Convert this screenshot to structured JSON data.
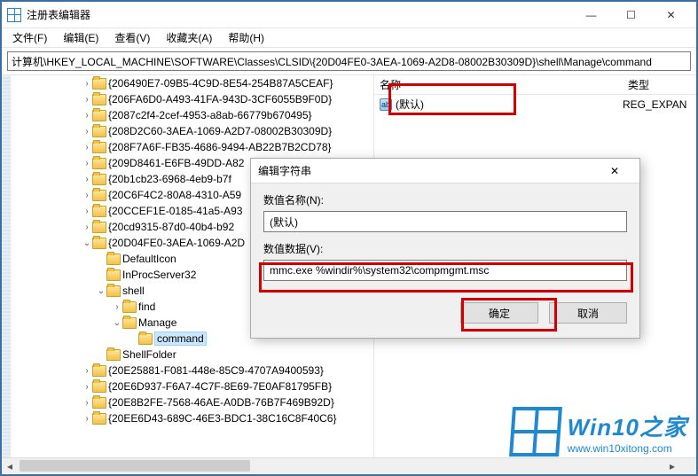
{
  "window": {
    "title": "注册表编辑器",
    "min_tip": "Minimize",
    "max_tip": "Maximize",
    "close_tip": "Close"
  },
  "menu": {
    "file": "文件(F)",
    "edit": "编辑(E)",
    "view": "查看(V)",
    "favorites": "收藏夹(A)",
    "help": "帮助(H)"
  },
  "address": "计算机\\HKEY_LOCAL_MACHINE\\SOFTWARE\\Classes\\CLSID\\{20D04FE0-3AEA-1069-A2D8-08002B30309D}\\shell\\Manage\\command",
  "tree": {
    "items": [
      {
        "label": "{206490E7-09B5-4C9D-8E54-254B87A5CEAF}",
        "indent": 2,
        "exp": ">"
      },
      {
        "label": "{206FA6D0-A493-41FA-943D-3CF6055B9F0D}",
        "indent": 2,
        "exp": ">"
      },
      {
        "label": "{2087c2f4-2cef-4953-a8ab-66779b670495}",
        "indent": 2,
        "exp": ">"
      },
      {
        "label": "{208D2C60-3AEA-1069-A2D7-08002B30309D}",
        "indent": 2,
        "exp": ">"
      },
      {
        "label": "{208F7A6F-FB35-4686-9494-AB22B7B2CD78}",
        "indent": 2,
        "exp": ">"
      },
      {
        "label": "{209D8461-E6FB-49DD-A82",
        "indent": 2,
        "exp": ">"
      },
      {
        "label": "{20b1cb23-6968-4eb9-b7f",
        "indent": 2,
        "exp": ">"
      },
      {
        "label": "{20C6F4C2-80A8-4310-A59",
        "indent": 2,
        "exp": ">"
      },
      {
        "label": "{20CCEF1E-0185-41a5-A93",
        "indent": 2,
        "exp": ">"
      },
      {
        "label": "{20cd9315-87d0-40b4-b92",
        "indent": 2,
        "exp": ">"
      },
      {
        "label": "{20D04FE0-3AEA-1069-A2D",
        "indent": 2,
        "exp": "v"
      },
      {
        "label": "DefaultIcon",
        "indent": 3,
        "exp": ""
      },
      {
        "label": "InProcServer32",
        "indent": 3,
        "exp": ""
      },
      {
        "label": "shell",
        "indent": 3,
        "exp": "v"
      },
      {
        "label": "find",
        "indent": 4,
        "exp": ">"
      },
      {
        "label": "Manage",
        "indent": 4,
        "exp": "v"
      },
      {
        "label": "command",
        "indent": 5,
        "exp": "",
        "selected": true
      },
      {
        "label": "ShellFolder",
        "indent": 3,
        "exp": ""
      },
      {
        "label": "{20E25881-F081-448e-85C9-4707A9400593}",
        "indent": 2,
        "exp": ">"
      },
      {
        "label": "{20E6D937-F6A7-4C7F-8E69-7E0AF81795FB}",
        "indent": 2,
        "exp": ">"
      },
      {
        "label": "{20E8B2FE-7568-46AE-A0DB-76B7F469B92D}",
        "indent": 2,
        "exp": ">"
      },
      {
        "label": "{20EE6D43-689C-46E3-BDC1-38C16C8F40C6}",
        "indent": 2,
        "exp": ">"
      }
    ]
  },
  "list": {
    "col_name": "名称",
    "col_type": "类型",
    "row_name": "(默认)",
    "row_type": "REG_EXPAN"
  },
  "dialog": {
    "title": "编辑字符串",
    "name_label": "数值名称(N):",
    "name_value": "(默认)",
    "data_label": "数值数据(V):",
    "data_value": "mmc.exe %windir%\\system32\\compmgmt.msc",
    "ok": "确定",
    "cancel": "取消"
  },
  "watermark": {
    "brand": "Win10之家",
    "url": "www.win10xitong.com"
  }
}
